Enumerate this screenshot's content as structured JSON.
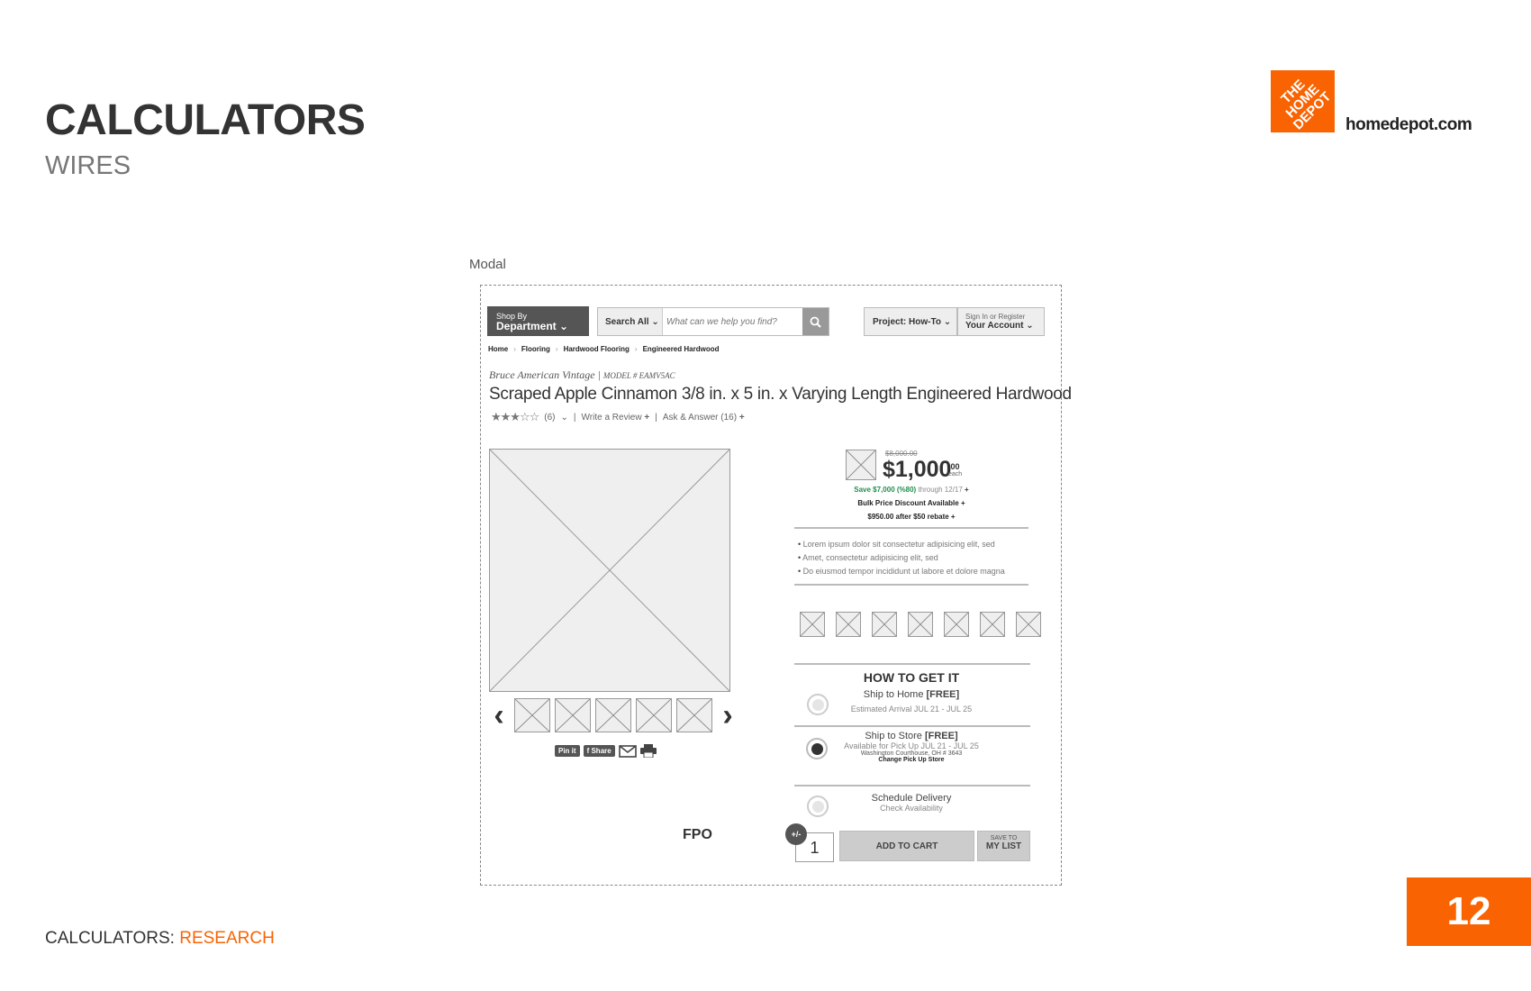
{
  "slide": {
    "title": "CALCULATORS",
    "subtitle": "WIRES",
    "brand_logo_text": "THE HOME DEPOT",
    "brand_url": "homedepot.com",
    "footer_prefix": "CALCULATORS: ",
    "footer_accent": "RESEARCH",
    "page_number": "12",
    "accent_color": "#f96302"
  },
  "modal": {
    "label": "Modal"
  },
  "header": {
    "dept_line1": "Shop By",
    "dept_line2": "Department",
    "search_scope": "Search All",
    "search_placeholder": "What can we help you find?",
    "project_label": "Project: How-To",
    "account_line1": "Sign In or Register",
    "account_line2": "Your Account"
  },
  "breadcrumb": [
    "Home",
    "Flooring",
    "Hardwood Flooring",
    "Engineered Hardwood"
  ],
  "product": {
    "brand": "Bruce American Vintage",
    "model": "MODEL # EAMV5AC",
    "title": "Scraped Apple Cinnamon 3/8 in. x 5 in. x Varying Length Engineered Hardwood",
    "rating_stars": "★★★☆☆",
    "review_count": "(6)",
    "write_review": "Write a Review",
    "ask_answer": "Ask & Answer (16)"
  },
  "share": {
    "pinit": "Pin it",
    "share": "Share"
  },
  "fpo_label": "FPO",
  "pricing": {
    "was_price": "$8,000.00",
    "price": "$1,000",
    "cents": ".00",
    "unit": "each",
    "save_text": "Save $7,000 (%80)",
    "save_through": "through 12/17",
    "bulk_text": "Bulk Price Discount Available",
    "rebate_text": "$950.00 after $50 rebate"
  },
  "bullets": [
    "Lorem ipsum dolor sit consectetur adipisicing elit, sed",
    "Amet, consectetur adipisicing elit, sed",
    "Do eiusmod tempor incididunt ut labore et dolore magna"
  ],
  "how_to_get_it": {
    "title": "HOW TO GET IT",
    "ship_home": {
      "label": "Ship to Home",
      "tag": "[FREE]",
      "detail": "Estimated Arrival JUL 21 - JUL 25",
      "selected": false
    },
    "ship_store": {
      "label": "Ship to Store",
      "tag": "[FREE]",
      "detail": "Available for Pick Up JUL 21 - JUL 25",
      "store": "Washington Courthouse, OH # 3643",
      "change_link": "Change Pick Up Store",
      "selected": true
    },
    "schedule": {
      "label": "Schedule Delivery",
      "detail": "Check Availability",
      "selected": false
    }
  },
  "cart": {
    "qty_toggle": "+/-",
    "quantity": "1",
    "add_to_cart": "ADD TO CART",
    "save_line1": "SAVE TO",
    "save_line2": "MY LIST"
  }
}
